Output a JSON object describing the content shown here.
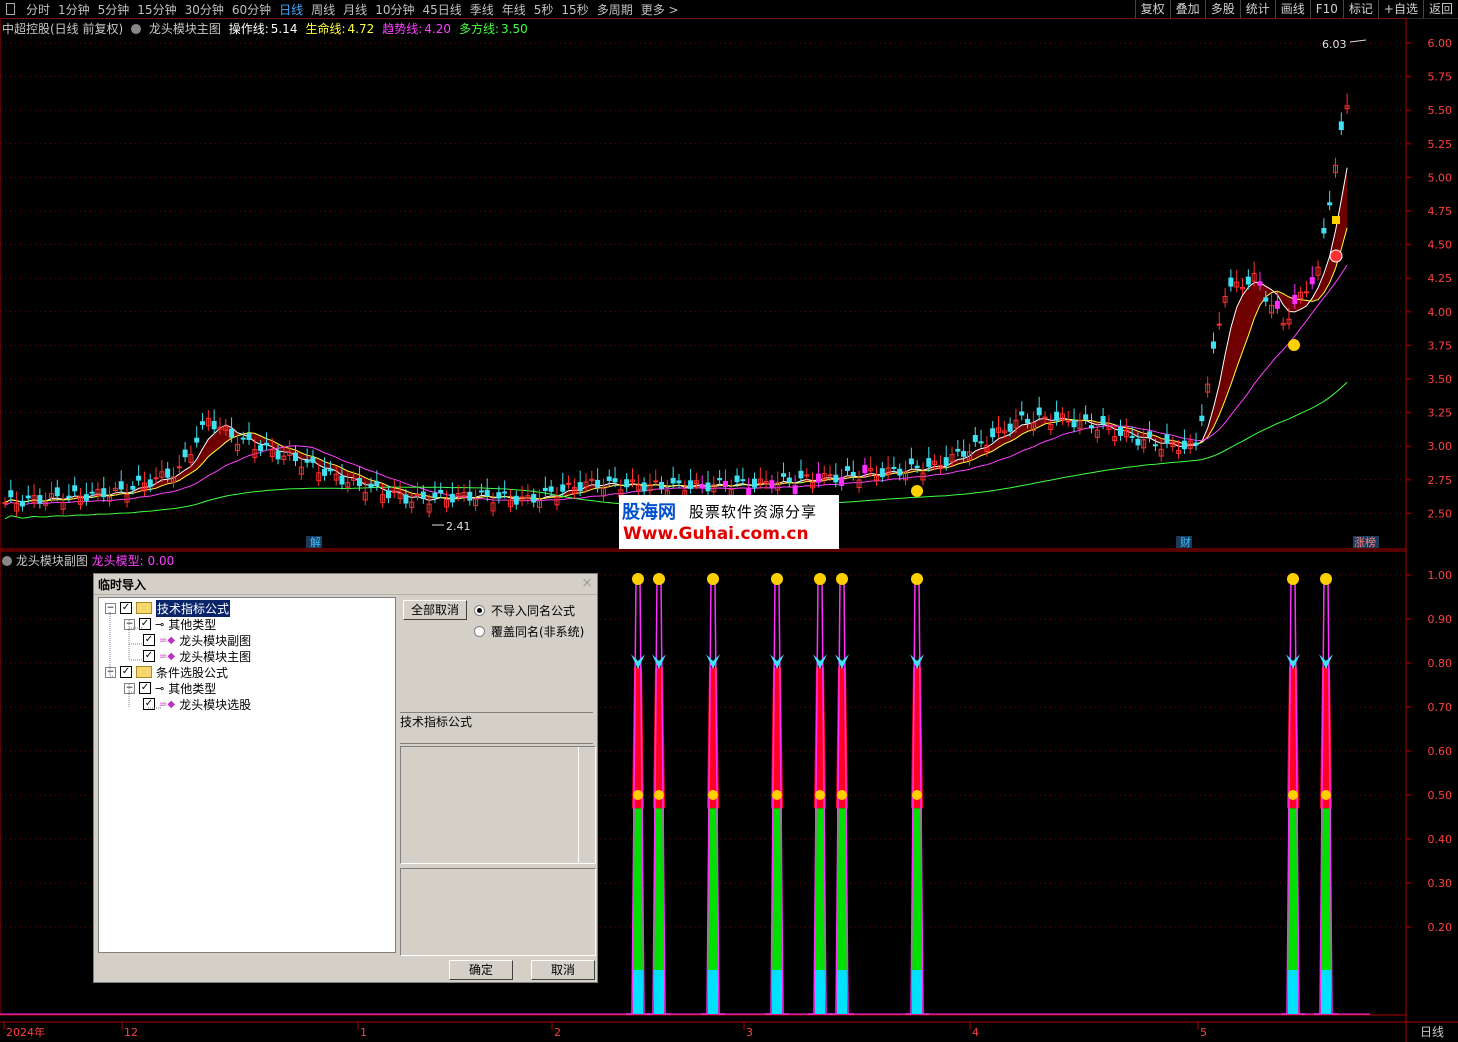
{
  "toolbar": {
    "periods": [
      "分时",
      "1分钟",
      "5分钟",
      "15分钟",
      "30分钟",
      "60分钟",
      "日线",
      "周线",
      "月线",
      "10分钟",
      "45日线",
      "季线",
      "年线",
      "5秒",
      "15秒",
      "多周期",
      "更多 >"
    ],
    "active_period": "日线",
    "right_tools": [
      "复权",
      "叠加",
      "多股",
      "统计",
      "画线",
      "F10",
      "标记",
      "+自选",
      "返回"
    ]
  },
  "info": {
    "stock": "中超控股(日线 前复权)",
    "indicator": "龙头模块主图",
    "lines": [
      {
        "label": "操作线:",
        "value": "5.14",
        "color": "#ffffff"
      },
      {
        "label": "生命线:",
        "value": "4.72",
        "color": "#ffff40"
      },
      {
        "label": "趋势线:",
        "value": "4.20",
        "color": "#ff40ff"
      },
      {
        "label": "多方线:",
        "value": "3.50",
        "color": "#40ff40"
      }
    ]
  },
  "sub_info": {
    "name": "龙头模块副图",
    "label": "龙头模型:",
    "value": "0.00"
  },
  "price_axis": [
    "6.00",
    "5.75",
    "5.50",
    "5.25",
    "5.00",
    "4.75",
    "4.50",
    "4.25",
    "4.00",
    "3.75",
    "3.50",
    "3.25",
    "3.00",
    "2.75",
    "2.50"
  ],
  "sub_axis": [
    "1.00",
    "0.90",
    "0.80",
    "0.70",
    "0.60",
    "0.50",
    "0.40",
    "0.30",
    "0.20"
  ],
  "time_axis": [
    "2024年",
    "12",
    "1",
    "2",
    "3",
    "4",
    "5"
  ],
  "period_label": "日线",
  "markers": {
    "high": "6.03",
    "low": "2.41",
    "jie": "解",
    "cai": "财",
    "zhang": "涨榜"
  },
  "logo": {
    "cn": "股海网",
    "tag": "股票软件资源分享",
    "url": "Www.Guhai.com.cn"
  },
  "dialog": {
    "title": "临时导入",
    "close": "×",
    "tree": [
      {
        "label": "技术指标公式",
        "level": 0,
        "kind": "folder",
        "selected": true
      },
      {
        "label": "其他类型",
        "level": 1,
        "kind": "key"
      },
      {
        "label": "龙头模块副图",
        "level": 2,
        "kind": "item"
      },
      {
        "label": "龙头模块主图",
        "level": 2,
        "kind": "item"
      },
      {
        "label": "条件选股公式",
        "level": 0,
        "kind": "folder"
      },
      {
        "label": "其他类型",
        "level": 1,
        "kind": "key"
      },
      {
        "label": "龙头模块选股",
        "level": 2,
        "kind": "item"
      }
    ],
    "cancel_all": "全部取消",
    "radio1": "不导入同名公式",
    "radio2": "覆盖同名(非系统)",
    "section": "技术指标公式",
    "ok": "确定",
    "cancel": "取消"
  }
}
